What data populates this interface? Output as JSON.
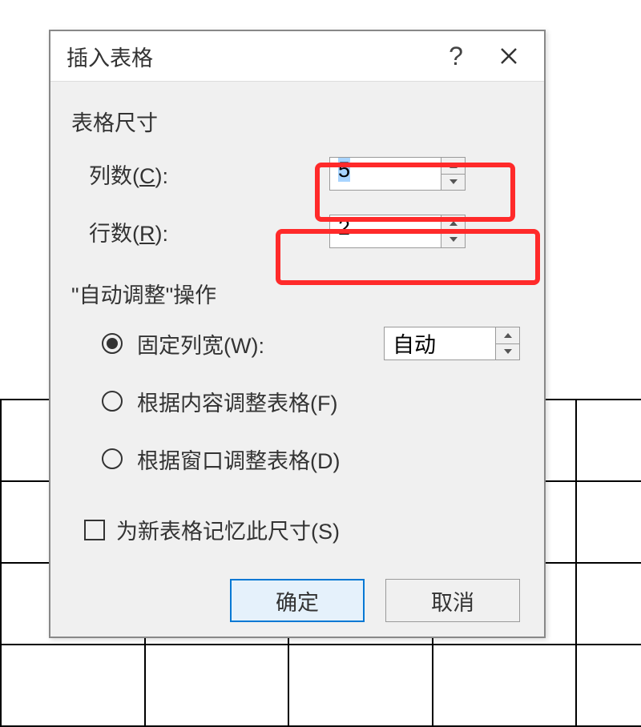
{
  "dialog": {
    "title": "插入表格",
    "size_section": "表格尺寸",
    "columns": {
      "label_pre": "列数(",
      "accelerator": "C",
      "label_post": "):",
      "value": "5"
    },
    "rows": {
      "label_pre": "行数(",
      "accelerator": "R",
      "label_post": "):",
      "value": "2"
    },
    "autofit_section": "\"自动调整\"操作",
    "fixed": {
      "label_pre": "固定列宽(",
      "accelerator": "W",
      "label_post": "):",
      "value": "自动",
      "checked": true
    },
    "fit_content": {
      "label_pre": "根据内容调整表格(",
      "accelerator": "F",
      "label_post": ")"
    },
    "fit_window": {
      "label_pre": "根据窗口调整表格(",
      "accelerator": "D",
      "label_post": ")"
    },
    "remember": {
      "label_pre": "为新表格记忆此尺寸(",
      "accelerator": "S",
      "label_post": ")"
    },
    "ok": "确定",
    "cancel": "取消"
  }
}
